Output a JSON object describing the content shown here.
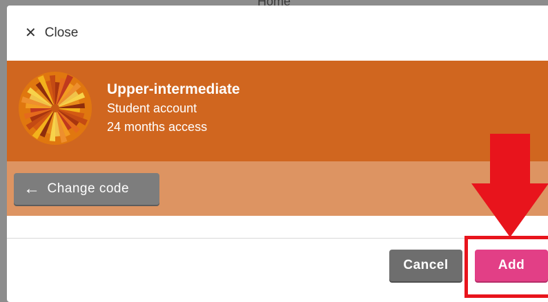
{
  "background": {
    "page_title": "Home"
  },
  "modal": {
    "close_label": "Close",
    "product": {
      "level": "Upper-intermediate",
      "account_type": "Student account",
      "access": "24 months access"
    },
    "change_code_label": "Change code",
    "cancel_label": "Cancel",
    "add_label": "Add"
  },
  "colors": {
    "header_band": "#d0661f",
    "change_band": "#dd9462",
    "add_button": "#e23f86",
    "cancel_button": "#6e6e6e",
    "annotation": "#e8141c"
  },
  "icons": {
    "close": "close-icon",
    "back": "arrow-left-icon",
    "logo": "course-logo-icon",
    "annotation": "down-arrow-annotation"
  }
}
